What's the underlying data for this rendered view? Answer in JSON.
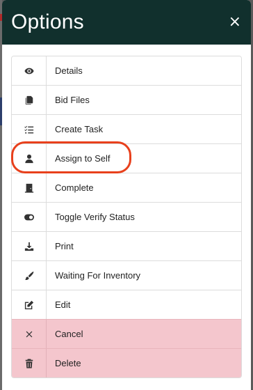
{
  "modal": {
    "title": "Options",
    "close_label": "×"
  },
  "items": [
    {
      "label": "Details",
      "icon": "eye-icon",
      "variant": "default"
    },
    {
      "label": "Bid Files",
      "icon": "copy-icon",
      "variant": "default"
    },
    {
      "label": "Create Task",
      "icon": "task-list-icon",
      "variant": "default"
    },
    {
      "label": "Assign to Self",
      "icon": "user-icon",
      "variant": "default",
      "highlighted": true
    },
    {
      "label": "Complete",
      "icon": "door-closed-icon",
      "variant": "default"
    },
    {
      "label": "Toggle Verify Status",
      "icon": "toggle-on-icon",
      "variant": "default"
    },
    {
      "label": "Print",
      "icon": "download-icon",
      "variant": "default"
    },
    {
      "label": "Waiting For Inventory",
      "icon": "paint-brush-icon",
      "variant": "default"
    },
    {
      "label": "Edit",
      "icon": "edit-icon",
      "variant": "default"
    },
    {
      "label": "Cancel",
      "icon": "times-icon",
      "variant": "danger"
    },
    {
      "label": "Delete",
      "icon": "trash-icon",
      "variant": "danger"
    }
  ],
  "colors": {
    "header_bg": "#11302d",
    "danger_bg": "#f4c6cd",
    "highlight_ring": "#e8401c"
  }
}
